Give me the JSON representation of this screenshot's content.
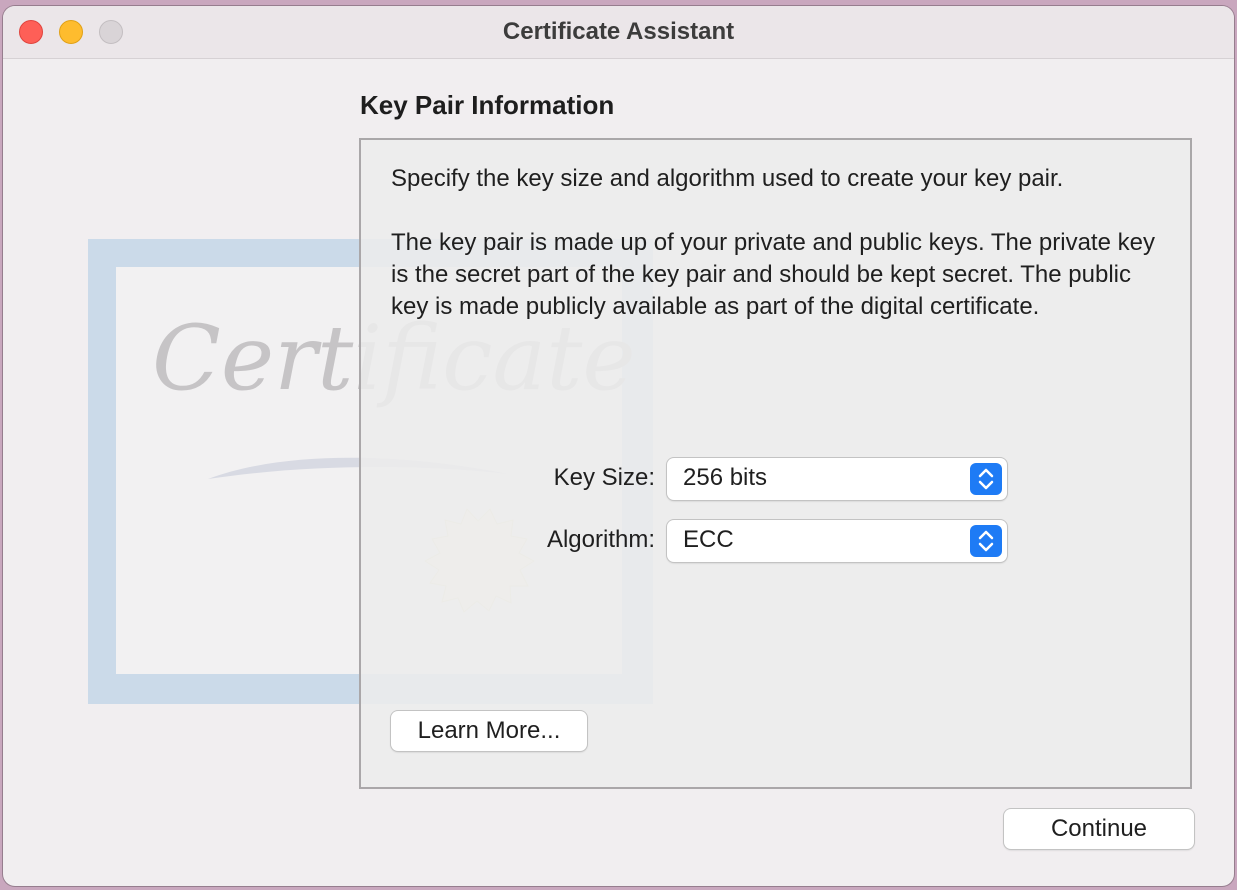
{
  "window": {
    "title": "Certificate Assistant"
  },
  "page": {
    "heading": "Key Pair Information",
    "description_1": "Specify the key size and algorithm used to create your key pair.",
    "description_2": "The key pair is made up of your private and public keys. The private key is the secret part of the key pair and should be kept secret. The public key is made publicly available as part of the digital certificate."
  },
  "fields": {
    "key_size": {
      "label": "Key Size:",
      "value": "256 bits"
    },
    "algorithm": {
      "label": "Algorithm:",
      "value": "ECC"
    }
  },
  "buttons": {
    "learn_more": "Learn More...",
    "continue": "Continue"
  },
  "artwork": {
    "watermark_text": "Certificate"
  },
  "icons": {
    "close": "close-icon",
    "minimize": "minimize-icon",
    "zoom": "zoom-icon",
    "stepper": "chevron-up-down-icon"
  },
  "colors": {
    "accent": "#1e7bf5",
    "close": "#fe5f57",
    "minimize": "#febc2e"
  }
}
